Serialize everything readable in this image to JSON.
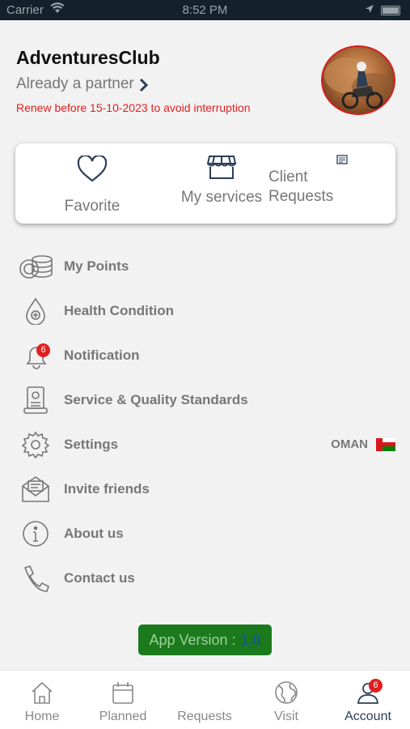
{
  "status_bar": {
    "carrier": "Carrier",
    "time": "8:52 PM"
  },
  "profile": {
    "name": "AdventuresClub",
    "partner_text": "Already a partner",
    "renew_notice": "Renew before 15-10-2023 to avoid interruption"
  },
  "quick_actions": {
    "favorite": "Favorite",
    "services": "My services",
    "requests_line1": "Client",
    "requests_line2": "Requests"
  },
  "menu": {
    "points": "My Points",
    "health": "Health Condition",
    "notification": "Notification",
    "notification_badge": "6",
    "standards": "Service & Quality Standards",
    "settings": "Settings",
    "country": "OMAN",
    "invite": "Invite friends",
    "about": "About us",
    "contact": "Contact us"
  },
  "app_version": {
    "label": "App Version :",
    "value": "1.0"
  },
  "tabbar": {
    "home": "Home",
    "planned": "Planned",
    "requests": "Requests",
    "visit": "Visit",
    "account": "Account",
    "account_badge": "6"
  },
  "colors": {
    "accent_red": "#e02020",
    "version_green": "#1b7a1b",
    "tab_active": "#2a3f57",
    "status_bar": "#12212b"
  }
}
